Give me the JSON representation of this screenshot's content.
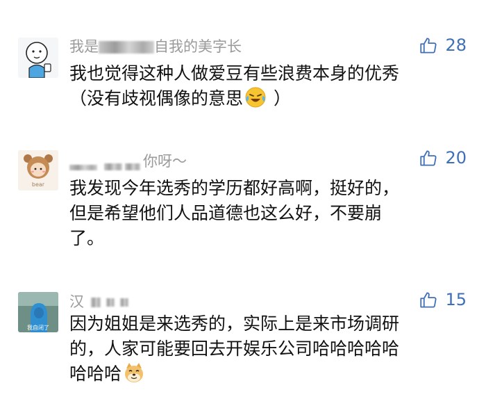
{
  "comments": [
    {
      "avatar_icon": "boy-drinking-cartoon-avatar",
      "username_visible": "我是",
      "username_tail": "自我的美字长",
      "likes": "28",
      "lines": [
        "我也觉得这种人做爱豆有些浪费本身的优秀",
        "（没有歧视偶像的意思",
        "）"
      ],
      "emoji_icon": "laughing-crying-emoji"
    },
    {
      "avatar_icon": "bear-hood-cartoon-avatar",
      "avatar_caption": "bear",
      "username_visible": "",
      "username_tail": "你呀～",
      "likes": "20",
      "lines": [
        "我发现今年选秀的学历都好高啊，挺好的，",
        "但是希望他们人品道德也这么好，不要崩",
        "了。"
      ]
    },
    {
      "avatar_icon": "blue-hooded-figure-avatar",
      "avatar_caption": "我自闭了",
      "username_visible": "汉",
      "username_tail": "",
      "likes": "15",
      "lines": [
        "因为姐姐是来选秀的，实际上是来市场调研",
        "的，人家可能要回去开娱乐公司哈哈哈哈哈",
        "哈哈哈"
      ],
      "emoji_icon": "doge-emoji"
    }
  ],
  "colors": {
    "like_blue": "#3f6fb6",
    "username_gray": "#9a9a9a"
  }
}
